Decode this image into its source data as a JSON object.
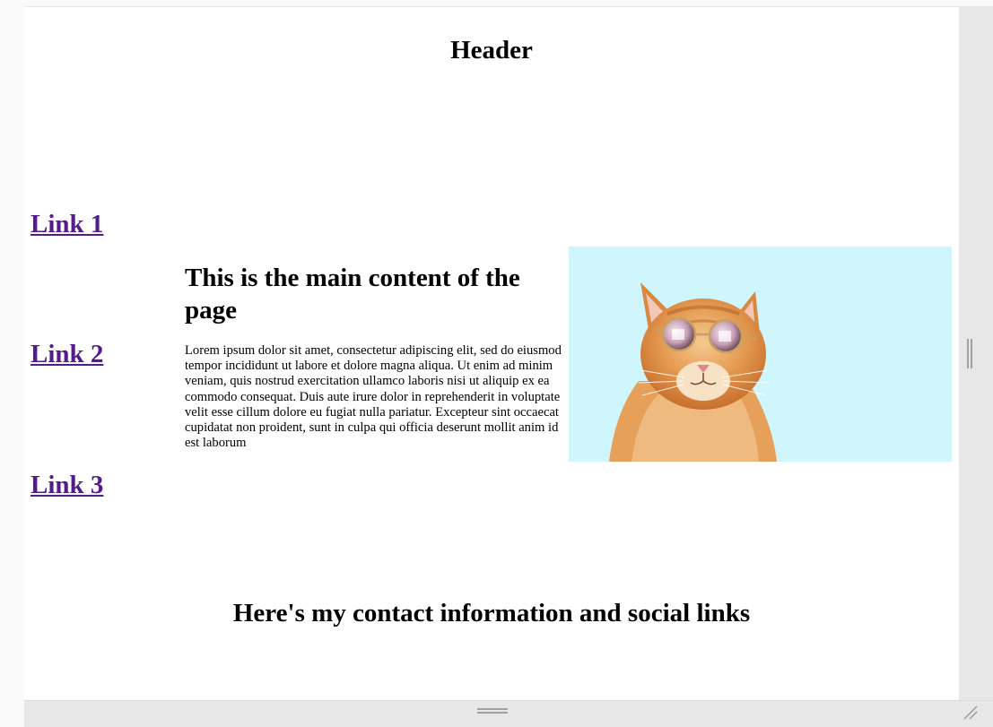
{
  "header": {
    "title": "Header"
  },
  "nav": {
    "links": [
      {
        "label": "Link 1"
      },
      {
        "label": "Link 2"
      },
      {
        "label": "Link 3"
      }
    ]
  },
  "main": {
    "heading": "This is the main content of the page",
    "body": "Lorem ipsum dolor sit amet, consectetur adipiscing elit, sed do eiusmod tempor incididunt ut labore et dolore magna aliqua. Ut enim ad minim veniam, quis nostrud exercitation ullamco laboris nisi ut aliquip ex ea commodo consequat. Duis aute irure dolor in reprehenderit in voluptate velit esse cillum dolore eu fugiat nulla pariatur. Excepteur sint occaecat cupidatat non proident, sunt in culpa qui officia deserunt mollit anim id est laborum",
    "image": {
      "subject": "orange cat wearing round sunglasses",
      "background_color": "#cff6fd"
    }
  },
  "footer": {
    "heading": "Here's my contact information and social links"
  },
  "colors": {
    "link_visited": "#551a8b",
    "text": "#000000",
    "resize_gutter": "#e7e7e7"
  }
}
